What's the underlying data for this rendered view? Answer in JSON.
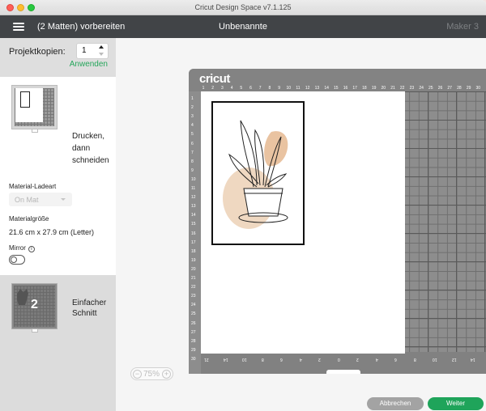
{
  "window": {
    "title": "Cricut Design Space  v7.1.125"
  },
  "header": {
    "left_title": "(2 Matten) vorbereiten",
    "center_title": "Unbenannte",
    "machine": "Maker 3"
  },
  "copies": {
    "label": "Projektkopien:",
    "value": "1",
    "apply_label": "Anwenden"
  },
  "mats": [
    {
      "line1": "Drucken,",
      "line2": "dann",
      "line3": "schneiden"
    },
    {
      "number": "2",
      "line1": "Einfacher",
      "line2": "Schnitt"
    }
  ],
  "settings": {
    "load_type_label": "Material-Ladeart",
    "load_type_value": "On Mat",
    "size_label": "Materialgröße",
    "size_value": "21.6 cm x 27.9 cm (Letter)",
    "mirror_label": "Mirror",
    "mirror_on": false
  },
  "canvas": {
    "brand": "cricut",
    "top_ruler": [
      "1",
      "2",
      "3",
      "4",
      "5",
      "6",
      "7",
      "8",
      "9",
      "10",
      "11",
      "12",
      "13",
      "14",
      "15",
      "16",
      "17",
      "18",
      "19",
      "20",
      "21",
      "22",
      "23",
      "24",
      "25",
      "26",
      "27",
      "28",
      "29",
      "30"
    ],
    "left_ruler": [
      "1",
      "2",
      "3",
      "4",
      "5",
      "6",
      "7",
      "8",
      "9",
      "10",
      "11",
      "12",
      "13",
      "14",
      "15",
      "16",
      "17",
      "18",
      "19",
      "20",
      "21",
      "22",
      "23",
      "24",
      "25",
      "26",
      "27",
      "28",
      "29",
      "30"
    ],
    "bottom_ruler": [
      "21",
      "14",
      "10",
      "8",
      "6",
      "4",
      "2",
      "0",
      "2",
      "4",
      "6",
      "8",
      "10",
      "12",
      "14"
    ]
  },
  "zoom": {
    "value": "75%",
    "minus": "−",
    "plus": "+"
  },
  "actions": {
    "cancel": "Abbrechen",
    "continue": "Weiter"
  },
  "colors": {
    "header": "#414447",
    "accent_green": "#1fa45a",
    "mat_gray": "#8d8d8d",
    "peach": "#e9c3a1"
  }
}
